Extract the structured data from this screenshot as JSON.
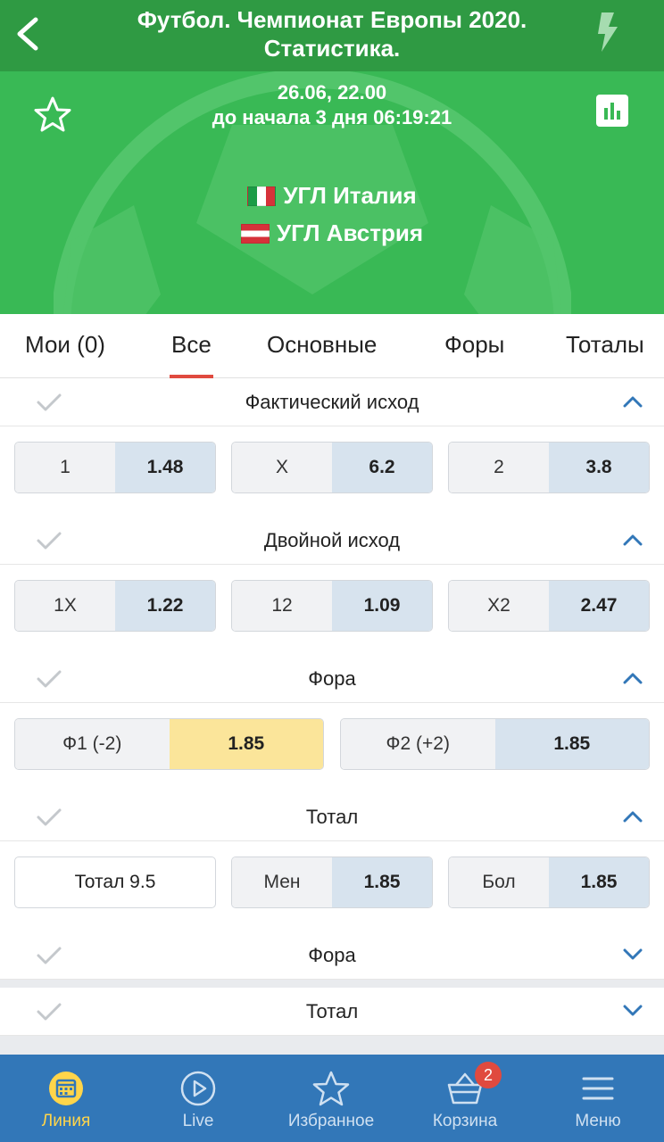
{
  "header": {
    "title_line1": "Футбол. Чемпионат Европы 2020.",
    "title_line2": "Статистика."
  },
  "event": {
    "date": "26.06, 22.00",
    "countdown": "до начала 3 дня 06:19:21",
    "team1": "УГЛ Италия",
    "team2": "УГЛ Австрия"
  },
  "tabs": [
    {
      "label": "Мои (0)"
    },
    {
      "label": "Все"
    },
    {
      "label": "Основные"
    },
    {
      "label": "Форы"
    },
    {
      "label": "Тоталы"
    }
  ],
  "sections": {
    "result": {
      "title": "Фактический исход",
      "odds": [
        {
          "name": "1",
          "value": "1.48"
        },
        {
          "name": "X",
          "value": "6.2"
        },
        {
          "name": "2",
          "value": "3.8"
        }
      ]
    },
    "double": {
      "title": "Двойной исход",
      "odds": [
        {
          "name": "1X",
          "value": "1.22"
        },
        {
          "name": "12",
          "value": "1.09"
        },
        {
          "name": "X2",
          "value": "2.47"
        }
      ]
    },
    "handicap": {
      "title": "Фора",
      "odds": [
        {
          "name": "Ф1 (-2)",
          "value": "1.85"
        },
        {
          "name": "Ф2 (+2)",
          "value": "1.85"
        }
      ]
    },
    "total": {
      "title": "Тотал",
      "line": "Тотал 9.5",
      "odds": [
        {
          "name": "Мен",
          "value": "1.85"
        },
        {
          "name": "Бол",
          "value": "1.85"
        }
      ]
    },
    "handicap2": {
      "title": "Фора"
    },
    "total2": {
      "title": "Тотал"
    }
  },
  "nav": {
    "items": [
      {
        "label": "Линия"
      },
      {
        "label": "Live"
      },
      {
        "label": "Избранное"
      },
      {
        "label": "Корзина",
        "badge": "2"
      },
      {
        "label": "Меню"
      }
    ]
  },
  "colors": {
    "header_green": "#2f9a43",
    "hero_green": "#39b955",
    "nav_blue": "#3277b8",
    "active_tab": "#e04a3f",
    "odd_value_bg": "#d7e3ee",
    "odd_selected_bg": "#fbe59a"
  }
}
